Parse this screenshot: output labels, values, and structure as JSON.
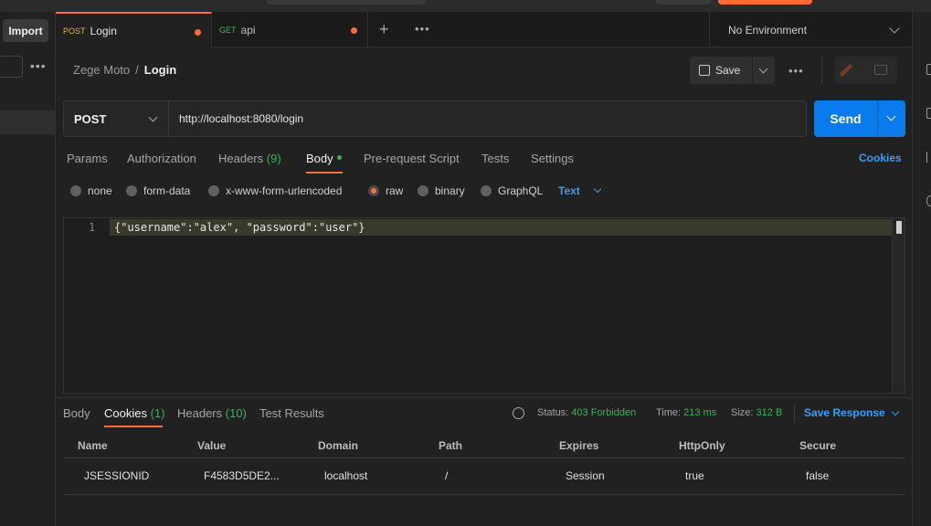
{
  "tabs": [
    {
      "method": "POST",
      "name": "Login"
    },
    {
      "method": "GET",
      "name": "api"
    }
  ],
  "sidebar": {
    "import_label": "Import"
  },
  "environment": "No Environment",
  "breadcrumb": {
    "collection": "Zege Moto",
    "separator": "/",
    "request": "Login"
  },
  "toolbar": {
    "save_label": "Save"
  },
  "request": {
    "method": "POST",
    "url": "http://localhost:8080/login",
    "send_label": "Send"
  },
  "request_tabs": {
    "params": "Params",
    "authorization": "Authorization",
    "headers": "Headers",
    "headers_count": "(9)",
    "body": "Body",
    "pre_request": "Pre-request Script",
    "tests": "Tests",
    "settings": "Settings",
    "cookies": "Cookies"
  },
  "body_types": {
    "none": "none",
    "form_data": "form-data",
    "urlencoded": "x-www-form-urlencoded",
    "raw": "raw",
    "binary": "binary",
    "graphql": "GraphQL",
    "selected": "raw",
    "format": "Text"
  },
  "editor": {
    "line_number": "1",
    "code": "{\"username\":\"alex\", \"password\":\"user\"}"
  },
  "response_tabs": {
    "body": "Body",
    "cookies": "Cookies",
    "cookies_count": "(1)",
    "headers": "Headers",
    "headers_count": "(10)",
    "test_results": "Test Results"
  },
  "response_meta": {
    "status_label": "Status:",
    "status_value": "403 Forbidden",
    "time_label": "Time:",
    "time_value": "213 ms",
    "size_label": "Size:",
    "size_value": "312 B",
    "save_response": "Save Response"
  },
  "cookies_table": {
    "columns": [
      "Name",
      "Value",
      "Domain",
      "Path",
      "Expires",
      "HttpOnly",
      "Secure"
    ],
    "row": [
      "JSESSIONID",
      "F4583D5DE2...",
      "localhost",
      "/",
      "Session",
      "true",
      "false"
    ]
  },
  "colors": {
    "accent": "#ff6c37",
    "send_blue": "#097bed",
    "link_blue": "#3f9cf3",
    "success_green": "#3fae5c"
  }
}
